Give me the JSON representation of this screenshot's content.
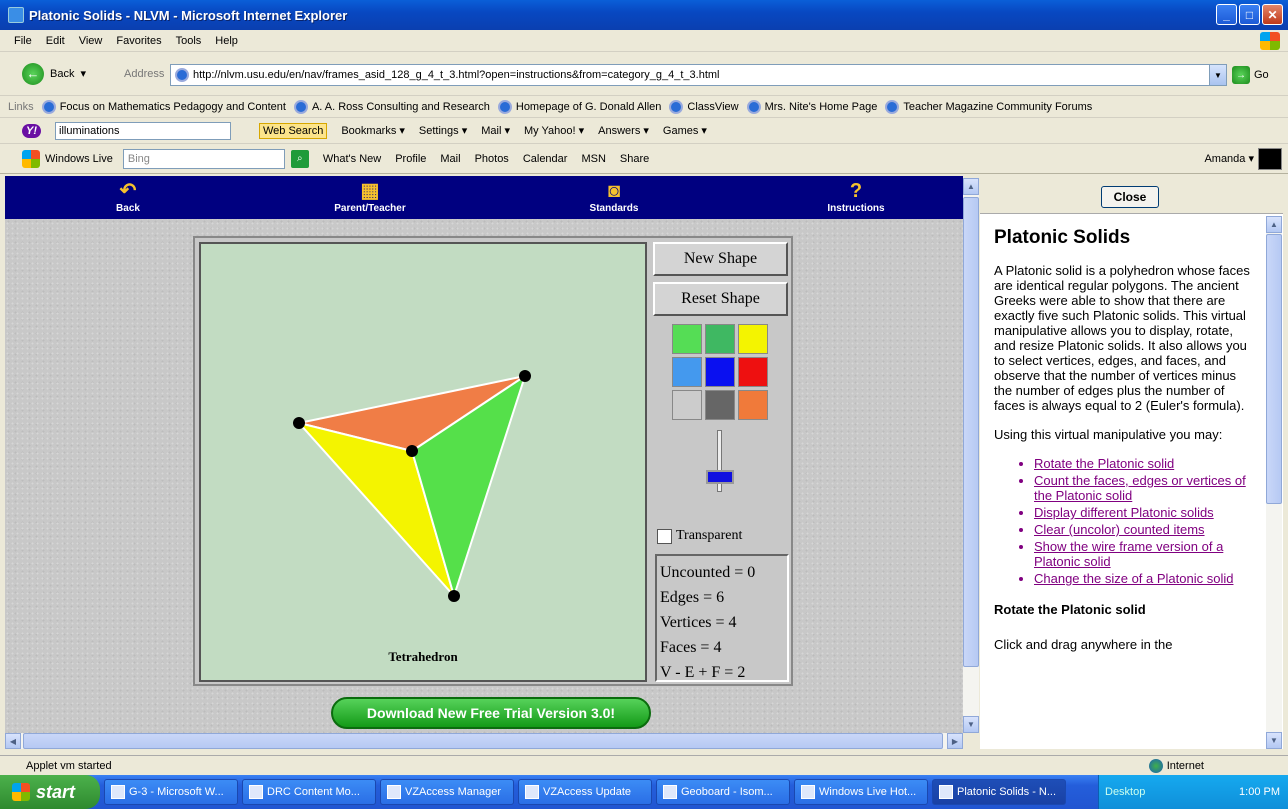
{
  "window": {
    "title": "Platonic Solids - NLVM - Microsoft Internet Explorer",
    "min": "_",
    "max": "□",
    "close": "✕"
  },
  "menu": [
    "File",
    "Edit",
    "View",
    "Favorites",
    "Tools",
    "Help"
  ],
  "addressbar": {
    "back_label": "Back",
    "address_label": "Address",
    "url": "http://nlvm.usu.edu/en/nav/frames_asid_128_g_4_t_3.html?open=instructions&from=category_g_4_t_3.html",
    "go_label": "Go"
  },
  "links": {
    "label": "Links",
    "items": [
      "Focus on Mathematics Pedagogy and Content",
      "A. A. Ross Consulting and Research",
      "Homepage of G. Donald Allen",
      "ClassView",
      "Mrs. Nite's Home Page",
      "Teacher Magazine Community Forums"
    ]
  },
  "yahoo": {
    "logo": "Y!",
    "search_value": "illuminations",
    "web_search": "Web Search",
    "items": [
      "Bookmarks ▾",
      "Settings ▾",
      "Mail ▾",
      "My Yahoo! ▾",
      "Answers ▾",
      "Games ▾"
    ]
  },
  "live": {
    "label": "Windows Live",
    "search_placeholder": "Bing",
    "items": [
      "What's New",
      "Profile",
      "Mail",
      "Photos",
      "Calendar",
      "MSN",
      "Share"
    ],
    "user": "Amanda ▾"
  },
  "nav": {
    "back": "Back",
    "parent": "Parent/Teacher",
    "standards": "Standards",
    "instructions": "Instructions"
  },
  "applet": {
    "new_shape": "New Shape",
    "reset_shape": "Reset Shape",
    "swatches": [
      "#55dd55",
      "#3fb862",
      "#f4f400",
      "#4499ee",
      "#0a10f0",
      "#ee1010",
      "#cccccc",
      "#666666",
      "#f07a3a"
    ],
    "transparent_label": "Transparent",
    "shape_name": "Tetrahedron",
    "stats": [
      "Uncounted = 0",
      "Edges = 6",
      "Vertices = 4",
      "Faces = 4",
      "V - E + F = 2"
    ],
    "face_colors": {
      "top": "#f07d46",
      "left": "#f4f400",
      "right": "#55e04a"
    }
  },
  "download": "Download New Free Trial Version 3.0!",
  "info": {
    "close": "Close",
    "title": "Platonic Solids",
    "para1": "A Platonic solid is a polyhedron whose faces are identical regular polygons. The ancient Greeks were able to show that there are exactly five such Platonic solids. This virtual manipulative allows you to display, rotate, and resize Platonic solids. It also allows you to select vertices, edges, and faces, and observe that the number of vertices minus the number of edges plus the number of faces is always equal to 2 (Euler's formula).",
    "para2": "Using this virtual manipulative you may:",
    "links": [
      "Rotate the Platonic solid",
      "Count the faces, edges or vertices of the Platonic solid",
      "Display different Platonic solids",
      "Clear (uncolor) counted items",
      "Show the wire frame version of a Platonic solid",
      "Change the size of a Platonic solid"
    ],
    "section": "Rotate the Platonic solid",
    "para3": "Click and drag anywhere in the"
  },
  "status": {
    "text": "Applet vm started",
    "zone": "Internet"
  },
  "taskbar": {
    "start": "start",
    "tasks": [
      "G-3 - Microsoft W...",
      "DRC Content Mo...",
      "VZAccess Manager",
      "VZAccess Update",
      "Geoboard - Isom...",
      "Windows Live Hot...",
      "Platonic Solids - N..."
    ],
    "desktop": "Desktop",
    "clock": "1:00 PM"
  }
}
